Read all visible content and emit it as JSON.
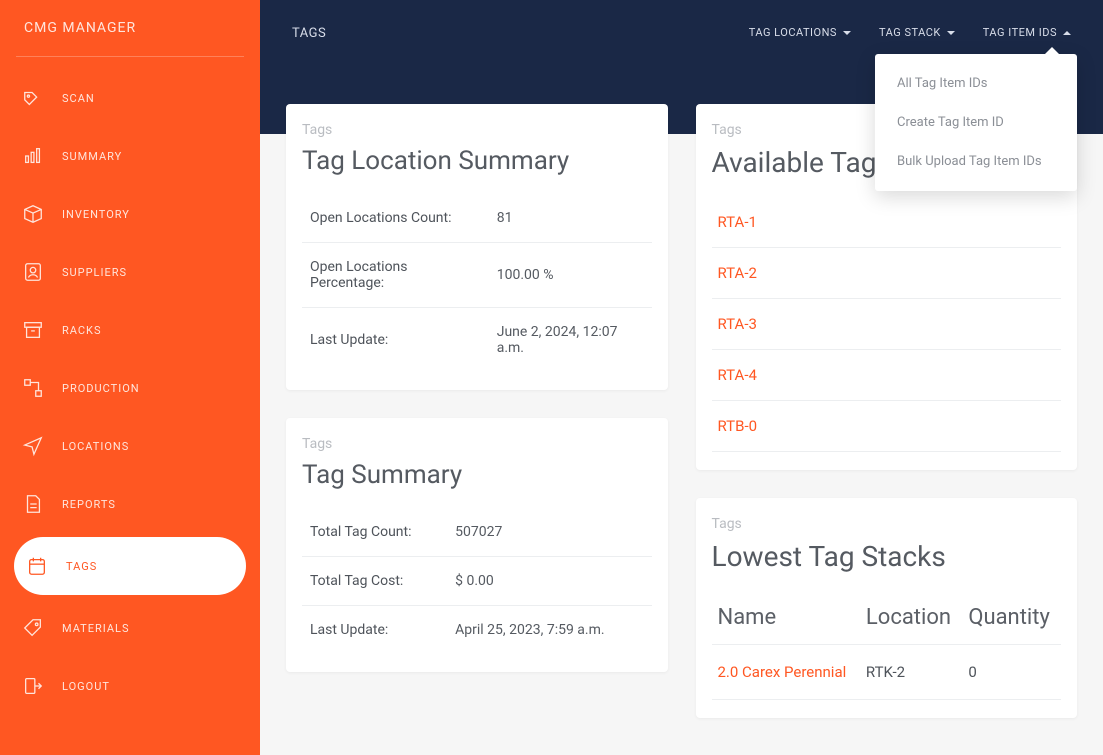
{
  "app_title": "CMG MANAGER",
  "sidebar": {
    "items": [
      {
        "label": "SCAN",
        "icon": "tag-scan-icon"
      },
      {
        "label": "SUMMARY",
        "icon": "bar-chart-icon"
      },
      {
        "label": "INVENTORY",
        "icon": "box-icon"
      },
      {
        "label": "SUPPLIERS",
        "icon": "id-badge-icon"
      },
      {
        "label": "RACKS",
        "icon": "archive-icon"
      },
      {
        "label": "PRODUCTION",
        "icon": "flow-icon"
      },
      {
        "label": "LOCATIONS",
        "icon": "paper-plane-icon"
      },
      {
        "label": "REPORTS",
        "icon": "document-icon"
      },
      {
        "label": "TAGS",
        "icon": "calendar-tag-icon",
        "active": true
      },
      {
        "label": "MATERIALS",
        "icon": "price-tag-icon"
      },
      {
        "label": "LOGOUT",
        "icon": "logout-icon"
      }
    ]
  },
  "header": {
    "breadcrumb": "TAGS",
    "menus": [
      {
        "label": "TAG LOCATIONS",
        "open": false
      },
      {
        "label": "TAG STACK",
        "open": false
      },
      {
        "label": "TAG ITEM IDS",
        "open": true
      }
    ],
    "dropdown": {
      "items": [
        "All Tag Item IDs",
        "Create Tag Item ID",
        "Bulk Upload Tag Item IDs"
      ]
    }
  },
  "cards": {
    "location_summary": {
      "eyebrow": "Tags",
      "title": "Tag Location Summary",
      "rows": [
        {
          "k": "Open Locations Count:",
          "v": "81"
        },
        {
          "k": "Open Locations Percentage:",
          "v": "100.00 %"
        },
        {
          "k": "Last Update:",
          "v": "June 2, 2024, 12:07 a.m."
        }
      ]
    },
    "available": {
      "eyebrow": "Tags",
      "title": "Available Tag",
      "items": [
        "RTA-1",
        "RTA-2",
        "RTA-3",
        "RTA-4",
        "RTB-0"
      ]
    },
    "summary": {
      "eyebrow": "Tags",
      "title": "Tag Summary",
      "rows": [
        {
          "k": "Total Tag Count:",
          "v": "507027"
        },
        {
          "k": "Total Tag Cost:",
          "v": "$ 0.00"
        },
        {
          "k": "Last Update:",
          "v": "April 25, 2023, 7:59 a.m."
        }
      ]
    },
    "lowest": {
      "eyebrow": "Tags",
      "title": "Lowest Tag Stacks",
      "columns": [
        "Name",
        "Location",
        "Quantity"
      ],
      "rows": [
        {
          "name": "2.0 Carex Perennial",
          "location": "RTK-2",
          "quantity": "0"
        }
      ]
    }
  }
}
